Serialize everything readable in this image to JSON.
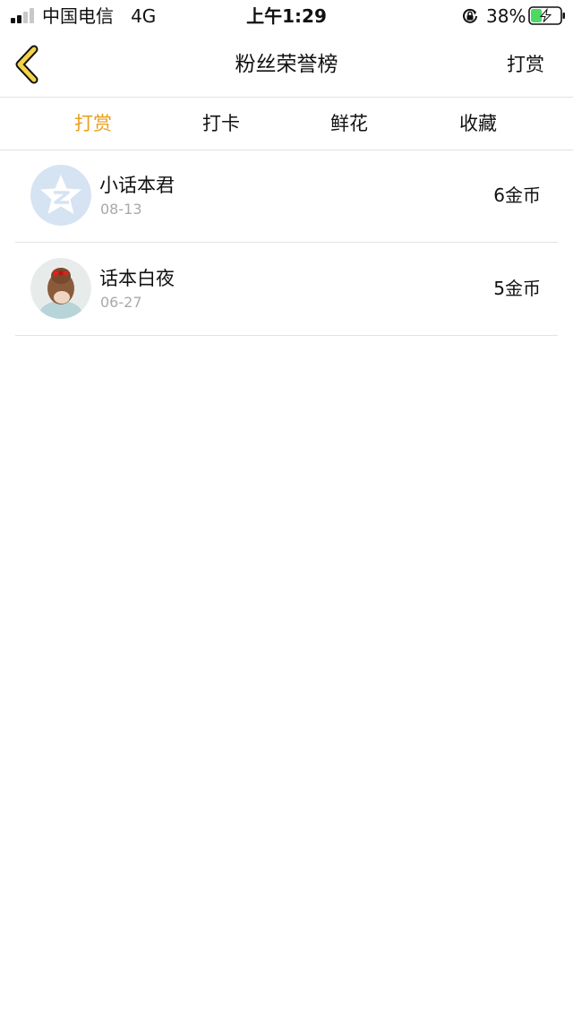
{
  "status_bar": {
    "carrier": "中国电信",
    "network": "4G",
    "time": "上午1:29",
    "battery_percent": "38%",
    "battery_level": 0.38,
    "signal_bars": 2,
    "icons": [
      "signal-icon",
      "rotation-lock-icon",
      "battery-charging-icon"
    ]
  },
  "nav": {
    "title": "粉丝荣誉榜",
    "back_icon": "chevron-left-icon",
    "action_label": "打赏"
  },
  "tabs": [
    {
      "label": "打赏",
      "active": true
    },
    {
      "label": "打卡",
      "active": false
    },
    {
      "label": "鲜花",
      "active": false
    },
    {
      "label": "收藏",
      "active": false
    }
  ],
  "list": [
    {
      "name": "小话本君",
      "date": "08-13",
      "amount": "6金币",
      "avatar": "qzone-default-avatar"
    },
    {
      "name": "话本白夜",
      "date": "06-27",
      "amount": "5金币",
      "avatar": "girl-photo-avatar"
    }
  ],
  "colors": {
    "accent": "#e8a01c",
    "back_arrow": "#f2d34a",
    "battery_charge": "#4cd964",
    "divider": "#e2e2e2",
    "secondary_text": "#a9a9a9"
  }
}
